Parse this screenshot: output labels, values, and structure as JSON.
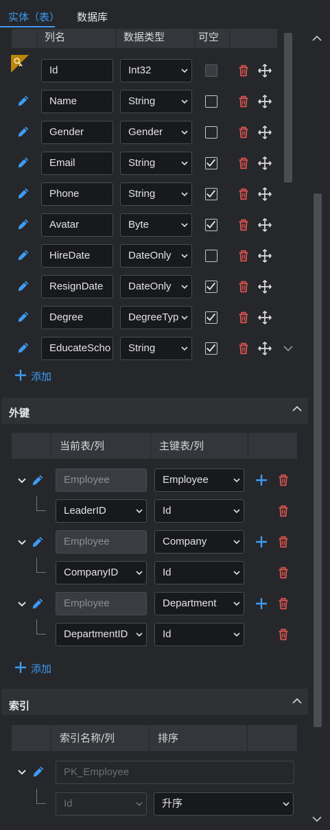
{
  "tabs": [
    {
      "label": "实体（表）",
      "active": true
    },
    {
      "label": "数据库",
      "active": false
    }
  ],
  "columns_header": [
    "列名",
    "数据类型",
    "可空"
  ],
  "columns": [
    {
      "name": "Id",
      "type": "Int32",
      "nullable": false,
      "primary_key": true
    },
    {
      "name": "Name",
      "type": "String",
      "nullable": false,
      "primary_key": false
    },
    {
      "name": "Gender",
      "type": "Gender",
      "nullable": false,
      "primary_key": false
    },
    {
      "name": "Email",
      "type": "String",
      "nullable": true,
      "primary_key": false
    },
    {
      "name": "Phone",
      "type": "String",
      "nullable": true,
      "primary_key": false
    },
    {
      "name": "Avatar",
      "type": "Byte",
      "nullable": true,
      "primary_key": false
    },
    {
      "name": "HireDate",
      "type": "DateOnly",
      "nullable": false,
      "primary_key": false
    },
    {
      "name": "ResignDate",
      "type": "DateOnly",
      "nullable": true,
      "primary_key": false
    },
    {
      "name": "Degree",
      "type": "DegreeTyp",
      "nullable": true,
      "primary_key": false
    },
    {
      "name": "EducateScho",
      "type": "String",
      "nullable": true,
      "primary_key": false
    }
  ],
  "add_label": "添加",
  "foreign_keys": {
    "title": "外键",
    "headers": [
      "当前表/列",
      "主键表/列"
    ],
    "items": [
      {
        "current_table": "Employee",
        "current_column": "LeaderID",
        "primary_table": "Employee",
        "primary_column": "Id"
      },
      {
        "current_table": "Employee",
        "current_column": "CompanyID",
        "primary_table": "Company",
        "primary_column": "Id"
      },
      {
        "current_table": "Employee",
        "current_column": "DepartmentID",
        "primary_table": "Department",
        "primary_column": "Id"
      }
    ]
  },
  "indexes": {
    "title": "索引",
    "headers": [
      "索引名称/列",
      "排序"
    ],
    "items": [
      {
        "name": "PK_Employee",
        "column": "Id",
        "sort": "升序"
      }
    ]
  },
  "colors": {
    "accent": "#3d9bf2",
    "danger": "#d9534f",
    "background": "#25272b"
  }
}
